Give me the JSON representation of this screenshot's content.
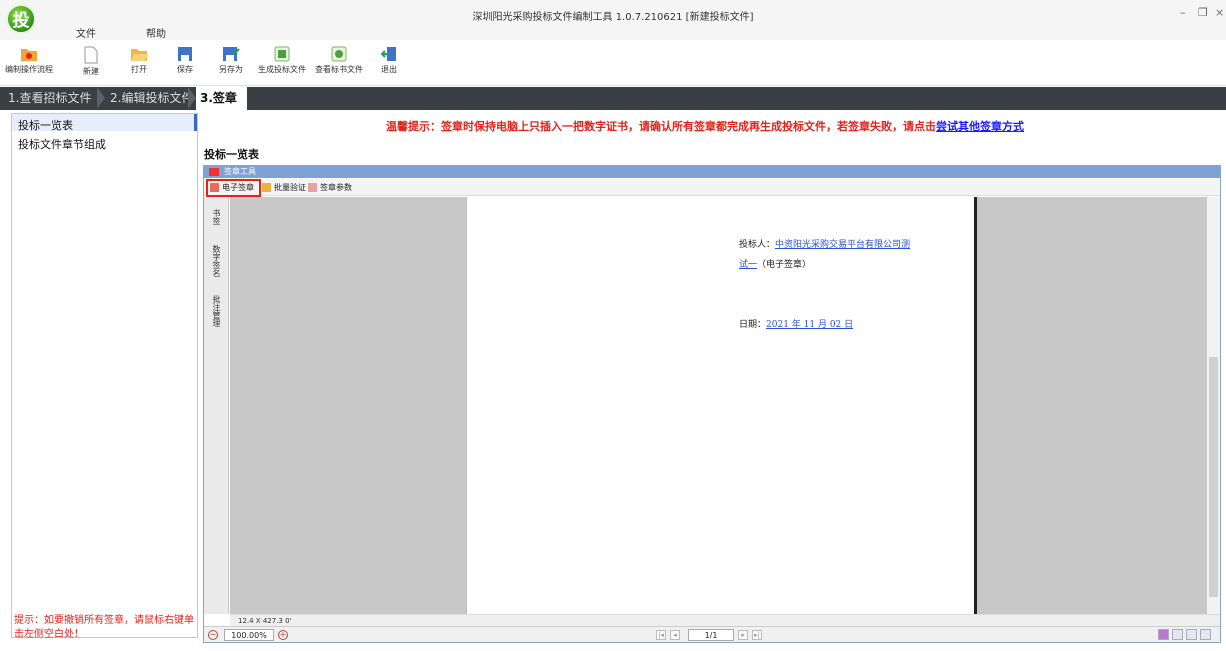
{
  "window": {
    "title": "深圳阳光采购投标文件编制工具 1.0.7.210621 [新建投标文件]",
    "logo_text": "投",
    "controls": [
      "–",
      "❐",
      "×"
    ]
  },
  "menu": [
    "文件",
    "帮助"
  ],
  "toolbar": [
    {
      "label": "编制操作流程",
      "icon": "folder-flow-icon"
    },
    {
      "label": "新建",
      "icon": "new-file-icon"
    },
    {
      "label": "打开",
      "icon": "open-folder-icon"
    },
    {
      "label": "保存",
      "icon": "save-icon"
    },
    {
      "label": "另存为",
      "icon": "save-as-icon"
    },
    {
      "label": "生成投标文件",
      "icon": "generate-file-icon"
    },
    {
      "label": "查看标书文件",
      "icon": "view-file-icon"
    },
    {
      "label": "退出",
      "icon": "exit-icon"
    }
  ],
  "tabs": [
    "1.查看招标文件",
    "2.编辑投标文件",
    "3.签章"
  ],
  "sidebar": {
    "items": [
      "投标一览表",
      "投标文件章节组成"
    ],
    "hint": "提示：如要撤销所有签章，请鼠标右键单击左侧空白处！"
  },
  "warning": {
    "text": "温馨提示：签章时保持电脑上只插入一把数字证书，请确认所有签章都完成再生成投标文件，若签章失败，请点击",
    "link": "尝试其他签章方式"
  },
  "section_title": "投标一览表",
  "signature_tool": {
    "header": "签章工具",
    "buttons": [
      "电子签章",
      "批量验证",
      "签章参数"
    ],
    "side_tabs": [
      "书签",
      "数字签名",
      "批注管理"
    ]
  },
  "document": {
    "bidder_label": "投标人：",
    "bidder_name_1": "中资阳光采购交易平台有限公司测",
    "bidder_name_2": "试一",
    "esign_note": "（电子签章）",
    "date_label": "日期：",
    "date_value": "2021 年 11 月 02 日"
  },
  "statusbar": {
    "coords": "12.4 X 427.3 0'",
    "zoom": "100.00%",
    "page": "1/1"
  },
  "colors": {
    "accent_red": "#e0231b",
    "link_blue": "#1a1aff",
    "tab_bar": "#3a3f44",
    "sig_header": "#7fa2d6"
  }
}
